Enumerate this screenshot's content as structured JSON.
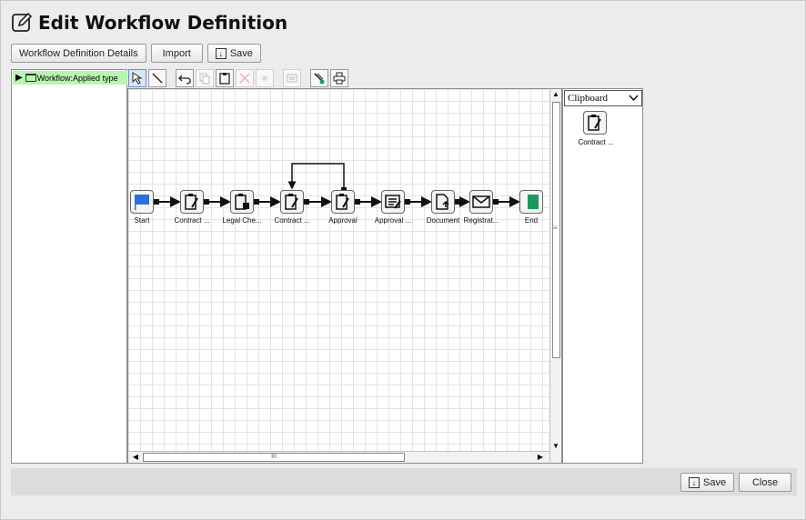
{
  "title": "Edit Workflow Definition",
  "top_buttons": {
    "details": "Workflow Definition Details",
    "import": "Import",
    "save": "Save"
  },
  "tree": {
    "item": "Workflow:Applied type"
  },
  "toolbar": {
    "icons": [
      "select-icon",
      "line-icon",
      "undo-icon",
      "copy-icon",
      "paste-icon",
      "delete-icon",
      "properties-icon",
      "list-icon",
      "auto-layout-icon",
      "print-icon"
    ]
  },
  "nodes": [
    {
      "label": "Start",
      "icon": "start-flag-icon"
    },
    {
      "label": "Contract ...",
      "icon": "clipboard-edit-icon"
    },
    {
      "label": "Legal Che...",
      "icon": "clipboard-check-icon"
    },
    {
      "label": "Contract ...",
      "icon": "clipboard-edit-icon"
    },
    {
      "label": "Approval",
      "icon": "clipboard-edit-icon"
    },
    {
      "label": "Approval ...",
      "icon": "document-lines-icon"
    },
    {
      "label": "Document",
      "icon": "document-upload-icon"
    },
    {
      "label": "Registrat...",
      "icon": "mail-icon"
    },
    {
      "label": "End",
      "icon": "end-flag-icon"
    }
  ],
  "clipboard": {
    "selected": "Clipboard",
    "item_label": "Contract ..."
  },
  "scroll_thumb_mark": "III",
  "scroll_side_mark": "≡",
  "bottom_buttons": {
    "save": "Save",
    "close": "Close"
  },
  "colors": {
    "tree_selected": "#b8f5b0",
    "start_blue": "#2a6fdb",
    "end_green": "#1a9a5a"
  }
}
